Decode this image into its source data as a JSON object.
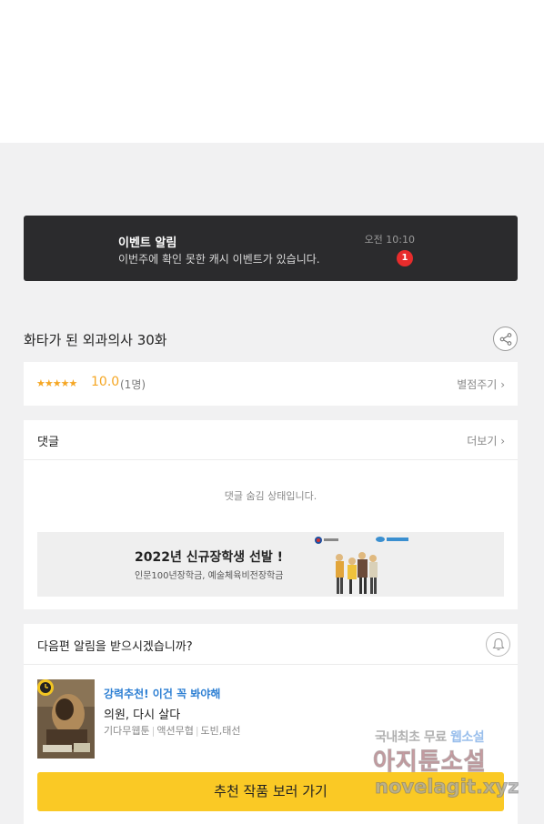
{
  "event": {
    "title": "이벤트 알림",
    "description": "이번주에 확인 못한 캐시 이벤트가 있습니다.",
    "time": "오전 10:10",
    "badge": "1"
  },
  "episode": {
    "title": "화타가 된 외과의사 30화",
    "share_icon": "share-icon"
  },
  "rating": {
    "stars": "★★★★★",
    "score": "10.0",
    "count": "(1명)",
    "rate_link": "별점주기",
    "chevron": "›"
  },
  "comments": {
    "title": "댓글",
    "more": "더보기",
    "chevron": "›",
    "hidden_message": "댓글 숨김 상태입니다.",
    "banner": {
      "title": "2022년 신규장학생 선발 !",
      "subtitle": "인문100년장학금, 예술체육비전장학금"
    }
  },
  "next_alert": {
    "question": "다음편 알림을 받으시겠습니까?",
    "bell_icon": "bell-icon",
    "recommendation": {
      "tag": "강력추천! 이건 꼭 봐야해",
      "title": "의원, 다시 살다",
      "genres": [
        "기다무웹툰",
        "액션무협",
        "도빈,태선"
      ]
    },
    "button": "추천 작품 보러 가기"
  },
  "watermark": {
    "line1_a": "국내최초 무료 ",
    "line1_b": "웹소설",
    "line2": "아지툰소설",
    "line3": "novelagit.xyz"
  }
}
